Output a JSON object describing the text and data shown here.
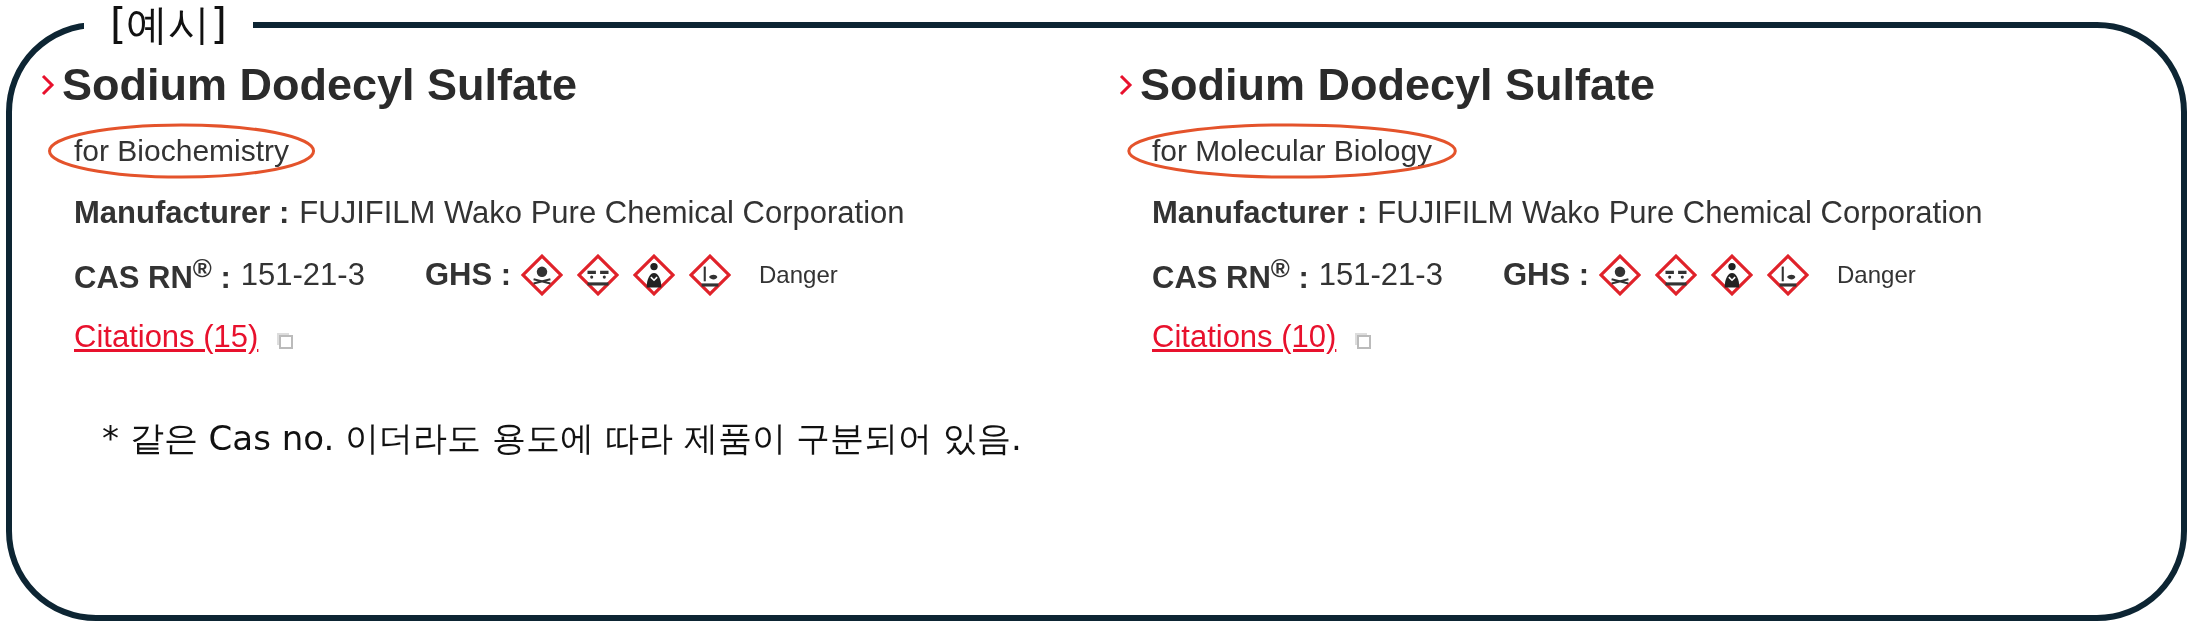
{
  "frame": {
    "legend": "[예시]"
  },
  "products": [
    {
      "name": "Sodium Dodecyl Sulfate",
      "grade": "for Biochemistry",
      "grade_circled": true,
      "manufacturer_label": "Manufacturer :",
      "manufacturer": "FUJIFILM Wako Pure Chemical Corporation",
      "cas_label": "CAS RN$^{®}$ :",
      "cas": "151-21-3",
      "ghs_label": "GHS :",
      "pictograms": [
        {
          "kind": "skull"
        },
        {
          "kind": "corrosion"
        },
        {
          "kind": "health"
        },
        {
          "kind": "environment"
        }
      ],
      "signal": "Danger",
      "citations": "Citations (15)"
    },
    {
      "name": "Sodium Dodecyl Sulfate",
      "grade": "for Molecular Biology",
      "grade_circled": true,
      "manufacturer_label": "Manufacturer :",
      "manufacturer": "FUJIFILM Wako Pure Chemical Corporation",
      "cas_label": "CAS RN$^{®}$ :",
      "cas": "151-21-3",
      "ghs_label": "GHS :",
      "pictograms": [
        {
          "kind": "skull"
        },
        {
          "kind": "corrosion"
        },
        {
          "kind": "health"
        },
        {
          "kind": "environment"
        }
      ],
      "signal": "Danger",
      "citations": "Citations (10)"
    }
  ],
  "note": "* 같은 Cas no. 이더라도 용도에 따라 제품이 구분되어 있음."
}
